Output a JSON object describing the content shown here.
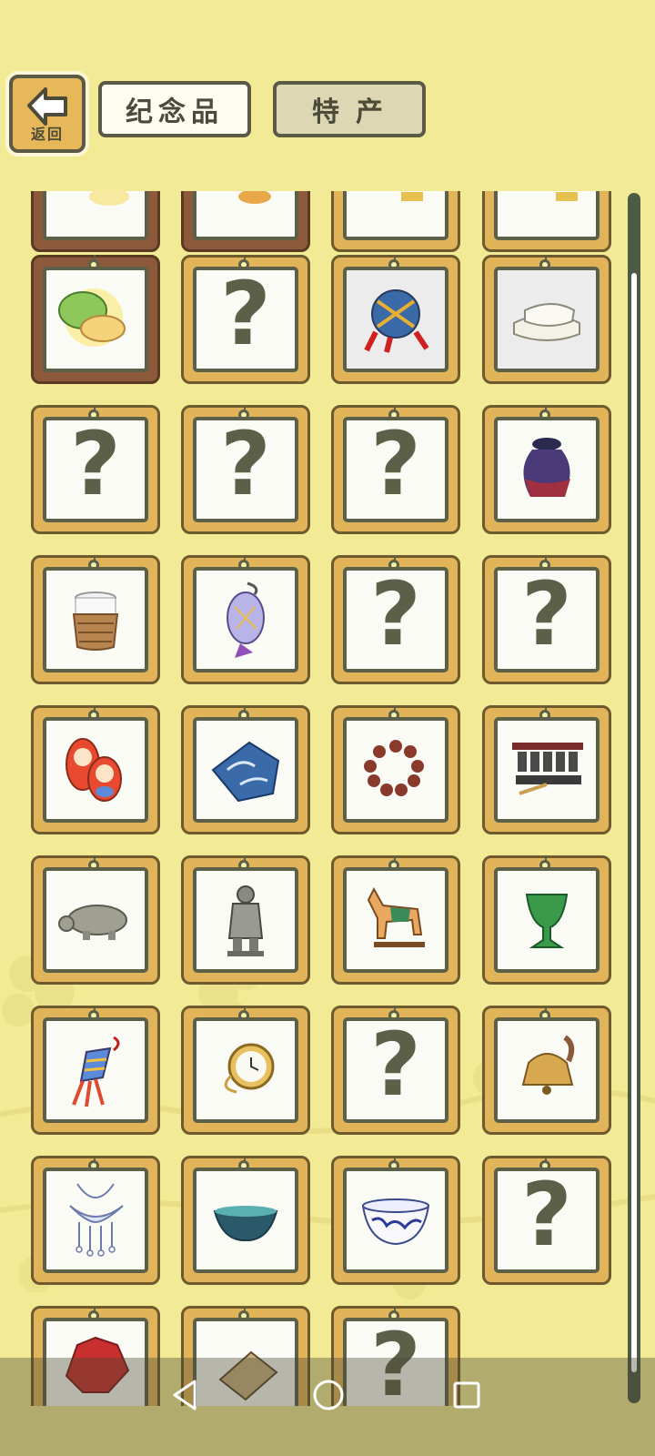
{
  "header": {
    "back_label": "返回",
    "tabs": [
      {
        "label": "纪念品",
        "active": true
      },
      {
        "label": "特产",
        "active": false
      }
    ]
  },
  "grid": {
    "rows": [
      [
        {
          "status": "collected",
          "icon": "partial-item-icon",
          "highlight": false
        },
        {
          "status": "collected",
          "icon": "partial-item-icon",
          "highlight": false
        },
        {
          "status": "collected",
          "icon": "partial-item-icon",
          "highlight": false
        },
        {
          "status": "collected",
          "icon": "partial-item-icon",
          "highlight": false
        }
      ],
      [
        {
          "status": "collected",
          "icon": "mooncake-icon",
          "highlight": true
        },
        {
          "status": "unknown",
          "icon": "question-mark-icon",
          "label": "?"
        },
        {
          "status": "collected",
          "icon": "temari-ball-icon",
          "highlight": true
        },
        {
          "status": "collected",
          "icon": "folded-towel-icon",
          "highlight": true
        }
      ],
      [
        {
          "status": "unknown",
          "icon": "question-mark-icon",
          "label": "?"
        },
        {
          "status": "unknown",
          "icon": "question-mark-icon",
          "label": "?"
        },
        {
          "status": "unknown",
          "icon": "question-mark-icon",
          "label": "?"
        },
        {
          "status": "collected",
          "icon": "ceramic-jar-icon"
        }
      ],
      [
        {
          "status": "collected",
          "icon": "woven-basket-cup-icon"
        },
        {
          "status": "collected",
          "icon": "lantern-charm-icon"
        },
        {
          "status": "unknown",
          "icon": "question-mark-icon",
          "label": "?"
        },
        {
          "status": "unknown",
          "icon": "question-mark-icon",
          "label": "?"
        }
      ],
      [
        {
          "status": "collected",
          "icon": "matryoshka-doll-icon"
        },
        {
          "status": "collected",
          "icon": "blue-cloth-icon"
        },
        {
          "status": "collected",
          "icon": "prayer-beads-icon"
        },
        {
          "status": "collected",
          "icon": "bell-rack-icon"
        }
      ],
      [
        {
          "status": "collected",
          "icon": "stone-turtle-icon"
        },
        {
          "status": "collected",
          "icon": "terracotta-warrior-icon"
        },
        {
          "status": "collected",
          "icon": "tang-horse-icon"
        },
        {
          "status": "collected",
          "icon": "jade-cup-icon"
        }
      ],
      [
        {
          "status": "collected",
          "icon": "tassel-knot-icon"
        },
        {
          "status": "collected",
          "icon": "pocket-watch-icon"
        },
        {
          "status": "unknown",
          "icon": "question-mark-icon",
          "label": "?"
        },
        {
          "status": "collected",
          "icon": "brass-bell-icon"
        }
      ],
      [
        {
          "status": "collected",
          "icon": "silver-necklace-icon"
        },
        {
          "status": "collected",
          "icon": "tea-bowl-icon"
        },
        {
          "status": "collected",
          "icon": "blue-white-bowl-icon"
        },
        {
          "status": "unknown",
          "icon": "question-mark-icon",
          "label": "?"
        }
      ],
      [
        {
          "status": "collected",
          "icon": "red-umbrella-icon"
        },
        {
          "status": "collected",
          "icon": "book-icon"
        },
        {
          "status": "unknown",
          "icon": "question-mark-icon",
          "label": "?"
        }
      ]
    ]
  },
  "navbar": {
    "buttons": [
      "back-nav-icon",
      "home-nav-icon",
      "recents-nav-icon"
    ]
  },
  "colors": {
    "background": "#f2ea94",
    "card_wood": "#e2b45a",
    "card_dark_wood": "#8c5a3a",
    "frame_border": "#5c6048",
    "question_mark": "#5c6048"
  }
}
